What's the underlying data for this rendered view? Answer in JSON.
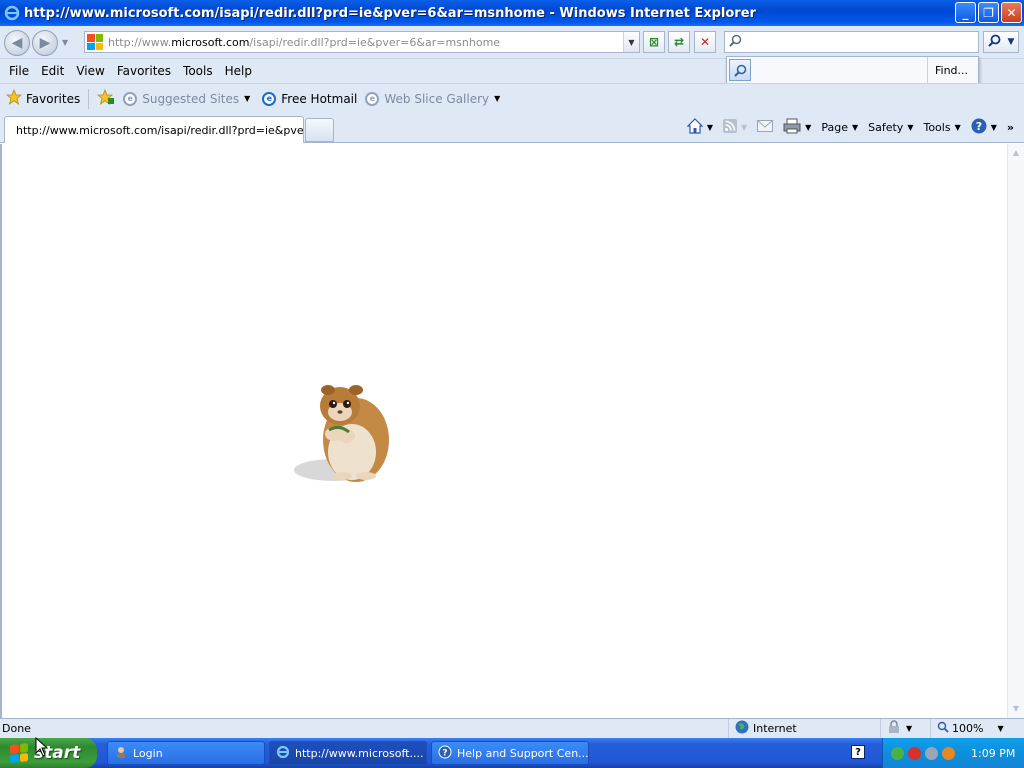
{
  "window": {
    "title": "http://www.microsoft.com/isapi/redir.dll?prd=ie&pver=6&ar=msnhome - Windows Internet Explorer",
    "minimize": "_",
    "restore": "❐",
    "close": "✕"
  },
  "address": {
    "prefix": "http://www.",
    "host": "microsoft.com",
    "suffix": "/isapi/redir.dll?prd=ie&pver=6&ar=msnhome",
    "search_value": ""
  },
  "find_popup": {
    "label": "Find..."
  },
  "menu": [
    "File",
    "Edit",
    "View",
    "Favorites",
    "Tools",
    "Help"
  ],
  "favorites": {
    "label": "Favorites",
    "items": [
      {
        "label": "Suggested Sites",
        "dim": true
      },
      {
        "label": "Free Hotmail",
        "dim": false
      },
      {
        "label": "Web Slice Gallery",
        "dim": true
      }
    ]
  },
  "tab": {
    "title": "http://www.microsoft.com/isapi/redir.dll?prd=ie&pver..."
  },
  "commands": {
    "page": "Page",
    "safety": "Safety",
    "tools": "Tools"
  },
  "status": {
    "text": "Done",
    "zone": "Internet",
    "zoom": "100%"
  },
  "taskbar": {
    "start": "start",
    "tasks": [
      {
        "label": "Login"
      },
      {
        "label": "http://www.microsoft...."
      },
      {
        "label": "Help and Support Cen..."
      }
    ],
    "clock": "1:09 PM"
  },
  "colors": {
    "accent": "#0054e3",
    "start_green": "#3c9d3c",
    "tray_blue": "#0d8fdc"
  }
}
